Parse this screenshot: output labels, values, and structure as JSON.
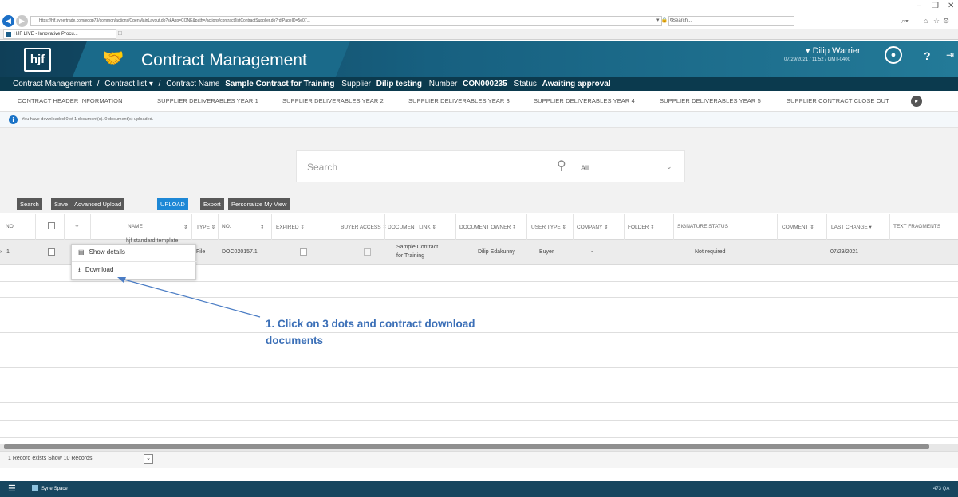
{
  "browser": {
    "url": "https://hjf.synertrade.com/eggp73/common/actions/OpenMainLayout.do?skApp=CONE&path=/actions/contract/listContractSupplier.do?rdfPageID=5e07...",
    "url_host": "hjf.synertrade.com",
    "search_placeholder": "Search...",
    "tab_title": "HJF LIVE - Innovative Procu...",
    "brand_color": "#176080"
  },
  "header": {
    "logo_text": "hjf",
    "app_title": "Contract Management",
    "user_name": "▾ Dilip Warrier",
    "timestamp": "07/29/2021 / 11:52 / GMT-0400",
    "help_label": "?"
  },
  "breadcrumb": {
    "root": "Contract Management",
    "sep": "/",
    "list": "Contract list ▾",
    "name_label": "Contract Name",
    "name_value": "Sample Contract for Training",
    "supplier_label": "Supplier",
    "supplier_value": "Dilip testing",
    "number_label": "Number",
    "number_value": "CON000235",
    "status_label": "Status",
    "status_value": "Awaiting approval"
  },
  "section_tabs": [
    "CONTRACT HEADER INFORMATION",
    "SUPPLIER DELIVERABLES YEAR 1",
    "SUPPLIER DELIVERABLES YEAR 2",
    "SUPPLIER DELIVERABLES YEAR 3",
    "SUPPLIER DELIVERABLES YEAR 4",
    "SUPPLIER DELIVERABLES YEAR 5",
    "SUPPLIER CONTRACT CLOSE OUT"
  ],
  "notice": {
    "text": "You have downloaded 0 of 1 document(s). 0 document(s) uploaded."
  },
  "search": {
    "placeholder": "Search",
    "scope": "All"
  },
  "toolbar": {
    "search_label": "Search",
    "save_label": "Save",
    "advanced_upload_label": "Advanced Upload",
    "upload_label": "UPLOAD",
    "export_label": "Export",
    "personalize_label": "Personalize My View",
    "accent_color": "#1e88d6"
  },
  "table": {
    "headers": {
      "no": "NO.",
      "actions": "↔",
      "name": "NAME",
      "type": "TYPE ⇕",
      "doc_no": "NO.",
      "expired": "EXPIRED ⇕",
      "buyer_access": "BUYER ACCESS ⇕",
      "document_link": "DOCUMENT LINK ⇕",
      "document_owner": "DOCUMENT OWNER ⇕",
      "user_type": "USER TYPE ⇕",
      "company": "COMPANY ⇕",
      "folder": "FOLDER ⇕",
      "signature_status": "SIGNATURE STATUS",
      "comment": "COMMENT ⇕",
      "last_change": "LAST CHANGE ▾",
      "text_fragments": "TEXT FRAGMENTS"
    },
    "row": {
      "no": "1",
      "name": "hjf standard template",
      "type": "File",
      "doc_no": "DOC020157.1",
      "document_link_line1": "Sample Contract",
      "document_link_line2": "for Training",
      "document_owner": "Dilip Edakunny",
      "user_type": "Buyer",
      "company": "-",
      "signature_status": "Not required",
      "last_change": "07/29/2021"
    }
  },
  "context_menu": {
    "show_details": "Show details",
    "download": "Download"
  },
  "annotation": {
    "line1": "1. Click on 3 dots and contract download",
    "line2": "documents",
    "color": "#3b6fb7"
  },
  "footer": {
    "records_text": "1 Record exists   Show   10 Records"
  },
  "taskbar": {
    "app_name": "SynerSpace",
    "right_text": "473 QA"
  }
}
